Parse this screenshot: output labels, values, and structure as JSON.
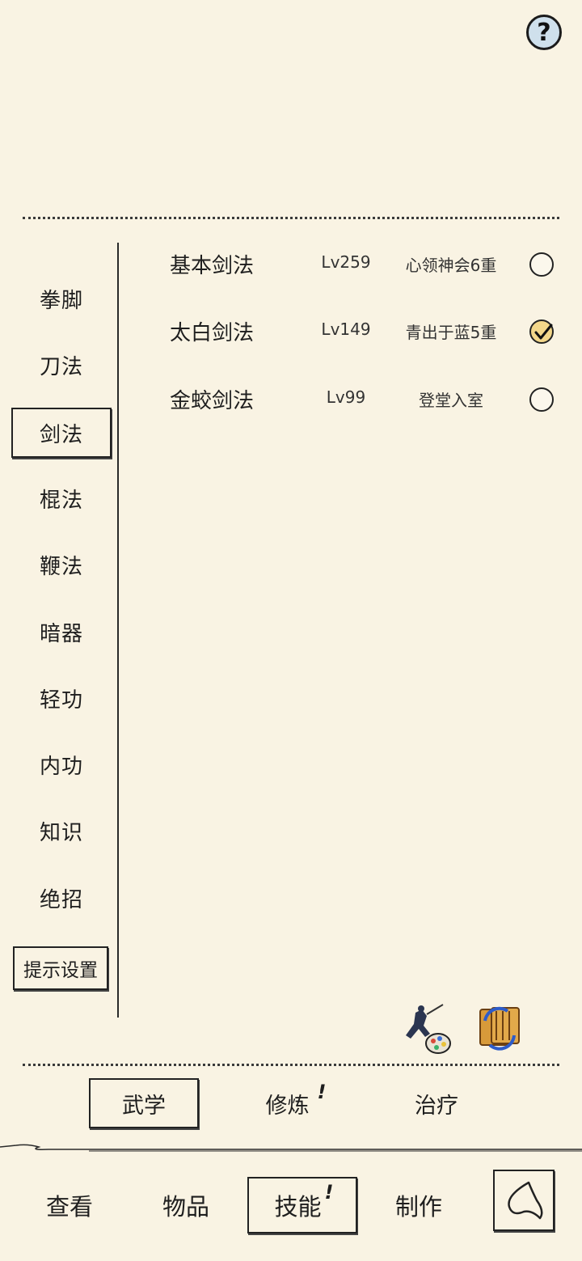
{
  "help": {
    "glyph": "?"
  },
  "sidebar": {
    "items": [
      {
        "label": "拳脚"
      },
      {
        "label": "刀法"
      },
      {
        "label": "剑法"
      },
      {
        "label": "棍法"
      },
      {
        "label": "鞭法"
      },
      {
        "label": "暗器"
      },
      {
        "label": "轻功"
      },
      {
        "label": "内功"
      },
      {
        "label": "知识"
      },
      {
        "label": "绝招"
      }
    ],
    "selected": "剑法",
    "tip_settings_label": "提示设置"
  },
  "skills": [
    {
      "name": "基本剑法",
      "level": "Lv259",
      "rank": "心领神会6重",
      "checked": false
    },
    {
      "name": "太白剑法",
      "level": "Lv149",
      "rank": "青出于蓝5重",
      "checked": true
    },
    {
      "name": "金蛟剑法",
      "level": "Lv99",
      "rank": "登堂入室",
      "checked": false
    }
  ],
  "actions": {
    "left_icon": "swordsman-palette-icon",
    "right_icon": "book-swap-icon"
  },
  "sub_tabs": [
    {
      "label": "武学",
      "selected": true,
      "alert": ""
    },
    {
      "label": "修炼",
      "selected": false,
      "alert": "!"
    },
    {
      "label": "治疗",
      "selected": false,
      "alert": ""
    }
  ],
  "bottom_nav": [
    {
      "label": "查看",
      "selected": false,
      "alert": ""
    },
    {
      "label": "物品",
      "selected": false,
      "alert": ""
    },
    {
      "label": "技能",
      "selected": true,
      "alert": "!"
    },
    {
      "label": "制作",
      "selected": false,
      "alert": ""
    }
  ],
  "colors": {
    "background": "#f9f3e3",
    "ink": "#1e1e1e",
    "help_fill": "#cfe0ec",
    "check_fill": "#f3d78a"
  }
}
